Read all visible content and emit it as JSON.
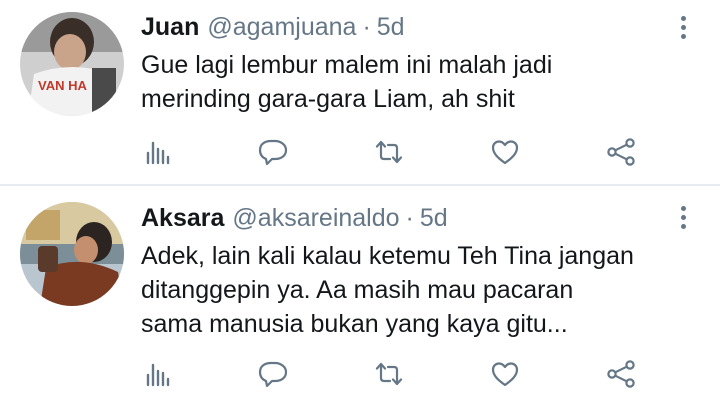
{
  "tweets": [
    {
      "name": "Juan",
      "handle": "@agamjuana",
      "separator": "·",
      "time": "5d",
      "lines": [
        "Gue lagi lembur malem ini malah jadi",
        "merinding gara-gara Liam, ah shit"
      ],
      "avatar_text": "VAN HA"
    },
    {
      "name": "Aksara",
      "handle": "@aksareinaldo",
      "separator": "·",
      "time": "5d",
      "lines": [
        "Adek, lain kali kalau ketemu Teh Tina jangan",
        "ditanggepin ya. Aa masih mau pacaran",
        "sama manusia bukan yang kaya gitu..."
      ]
    }
  ],
  "icons": [
    "analytics-icon",
    "reply-icon",
    "retweet-icon",
    "like-icon",
    "share-icon",
    "more-icon"
  ],
  "colors": {
    "icon": "#657786",
    "divider": "#e6ecf0",
    "text": "#14171a"
  }
}
